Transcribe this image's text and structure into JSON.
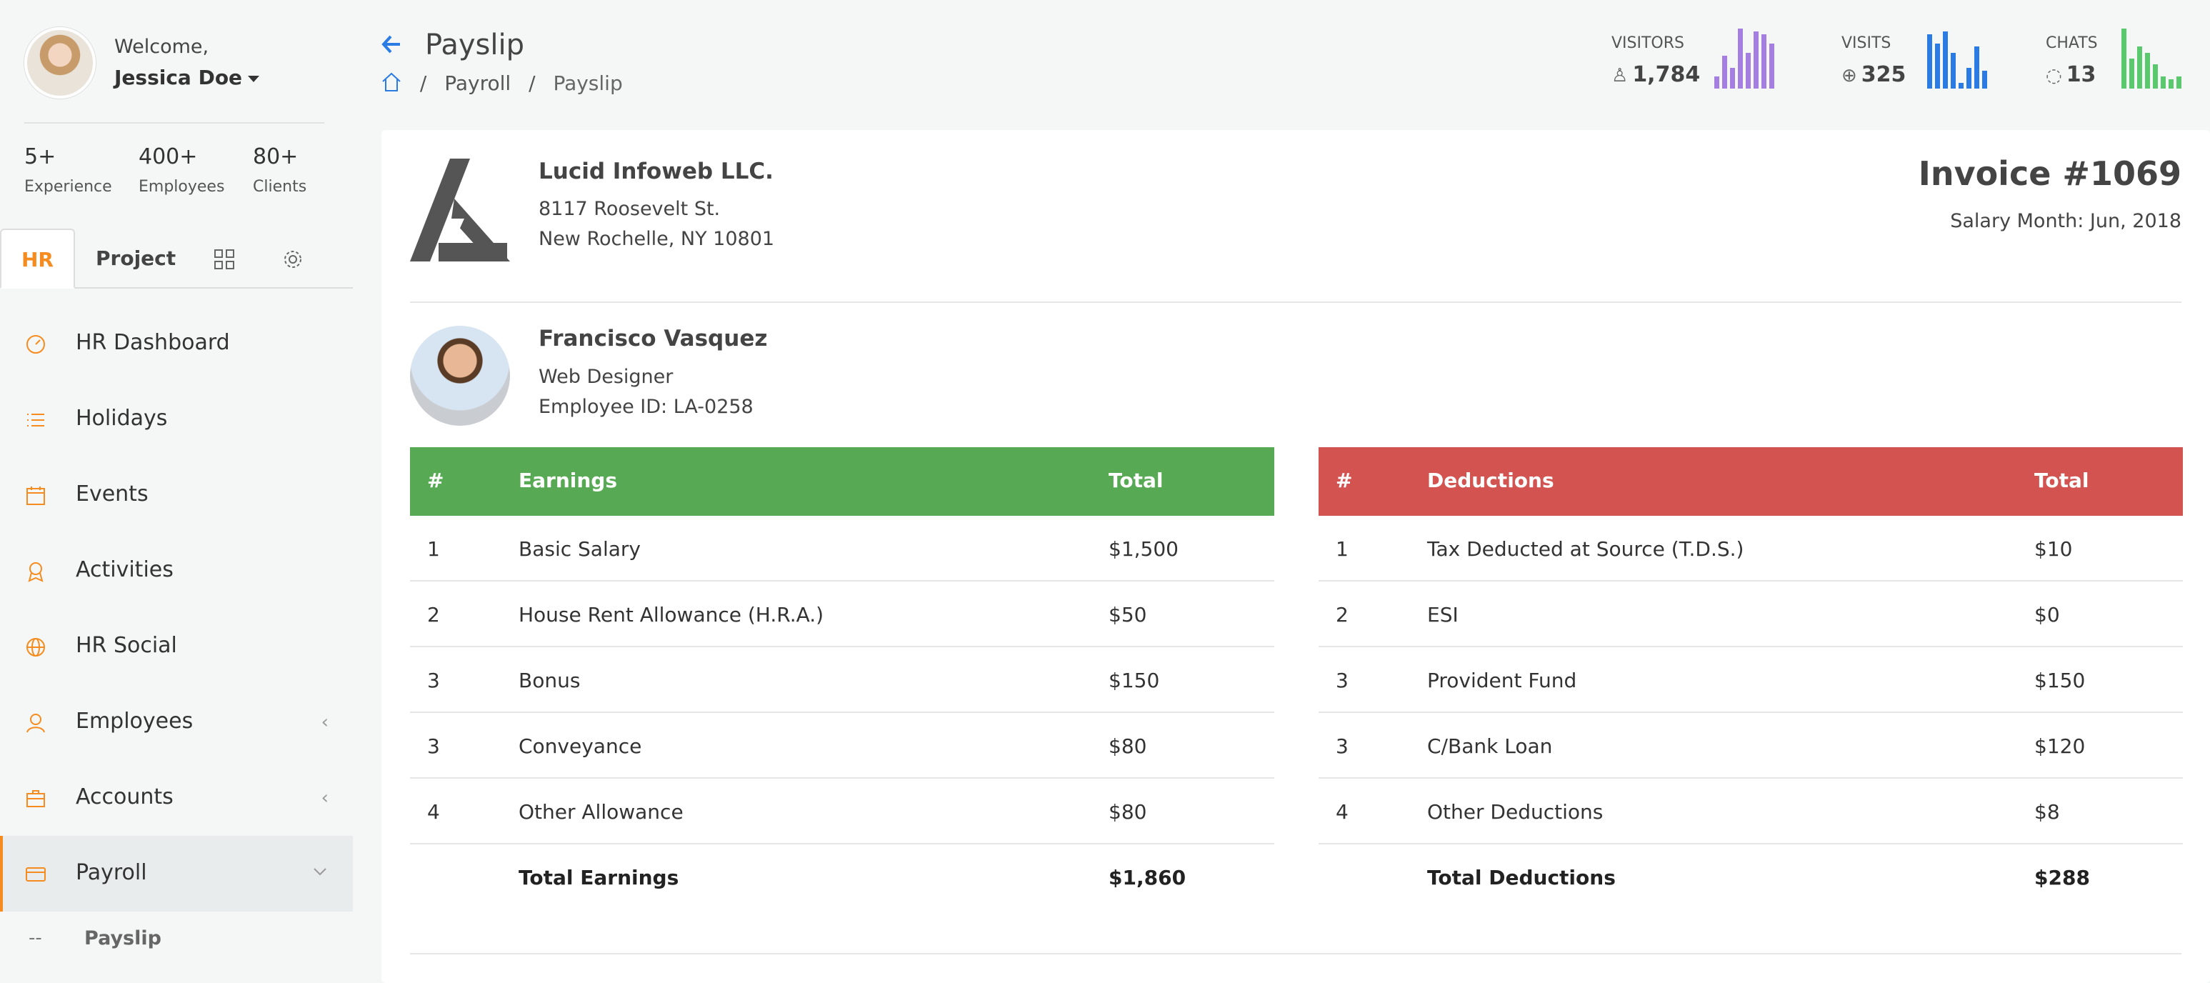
{
  "user": {
    "welcome": "Welcome,",
    "name": "Jessica Doe"
  },
  "stats": [
    {
      "value": "5+",
      "label": "Experience"
    },
    {
      "value": "400+",
      "label": "Employees"
    },
    {
      "value": "80+",
      "label": "Clients"
    }
  ],
  "side_tabs": {
    "hr": "HR",
    "project": "Project"
  },
  "menu": [
    {
      "label": "HR Dashboard",
      "icon": "speedometer-icon"
    },
    {
      "label": "Holidays",
      "icon": "list-icon"
    },
    {
      "label": "Events",
      "icon": "calendar-icon"
    },
    {
      "label": "Activities",
      "icon": "badge-icon"
    },
    {
      "label": "HR Social",
      "icon": "globe-icon"
    },
    {
      "label": "Employees",
      "icon": "users-icon"
    },
    {
      "label": "Accounts",
      "icon": "briefcase-icon"
    },
    {
      "label": "Payroll",
      "icon": "credit-card-icon"
    }
  ],
  "submenu": {
    "dash": "--",
    "label": "Payslip"
  },
  "header": {
    "title": "Payslip",
    "breadcrumb": [
      "Payroll",
      "Payslip"
    ],
    "separator": "/"
  },
  "metrics": [
    {
      "label": "VISITORS",
      "value": "1,784",
      "color": "#a47ee0",
      "bars": [
        0.2,
        0.55,
        0.35,
        1.0,
        0.6,
        0.95,
        0.9,
        0.75
      ]
    },
    {
      "label": "VISITS",
      "value": "325",
      "color": "#2b7be4",
      "bars": [
        0.9,
        0.75,
        0.95,
        0.6,
        0.1,
        0.35,
        0.7,
        0.3
      ]
    },
    {
      "label": "CHATS",
      "value": "13",
      "color": "#5ac86d",
      "bars": [
        1.0,
        0.5,
        0.7,
        0.6,
        0.4,
        0.2,
        0.15,
        0.2
      ]
    }
  ],
  "company": {
    "name": "Lucid Infoweb LLC.",
    "address1": "8117 Roosevelt St.",
    "address2": "New Rochelle, NY 10801"
  },
  "invoice": {
    "number": "Invoice #1069",
    "salary_month": "Salary Month: Jun, 2018"
  },
  "employee": {
    "name": "Francisco Vasquez",
    "role": "Web Designer",
    "id": "Employee ID: LA-0258"
  },
  "earnings": {
    "color": "#57aa53",
    "headers": [
      "#",
      "Earnings",
      "Total"
    ],
    "rows": [
      [
        "1",
        "Basic Salary",
        "$1,500"
      ],
      [
        "2",
        "House Rent Allowance (H.R.A.)",
        "$50"
      ],
      [
        "3",
        "Bonus",
        "$150"
      ],
      [
        "3",
        "Conveyance",
        "$80"
      ],
      [
        "4",
        "Other Allowance",
        "$80"
      ]
    ],
    "total_label": "Total Earnings",
    "total_value": "$1,860"
  },
  "deductions": {
    "color": "#d25350",
    "headers": [
      "#",
      "Deductions",
      "Total"
    ],
    "rows": [
      [
        "1",
        "Tax Deducted at Source (T.D.S.)",
        "$10"
      ],
      [
        "2",
        "ESI",
        "$0"
      ],
      [
        "3",
        "Provident Fund",
        "$150"
      ],
      [
        "3",
        "C/Bank Loan",
        "$120"
      ],
      [
        "4",
        "Other Deductions",
        "$8"
      ]
    ],
    "total_label": "Total Deductions",
    "total_value": "$288"
  }
}
